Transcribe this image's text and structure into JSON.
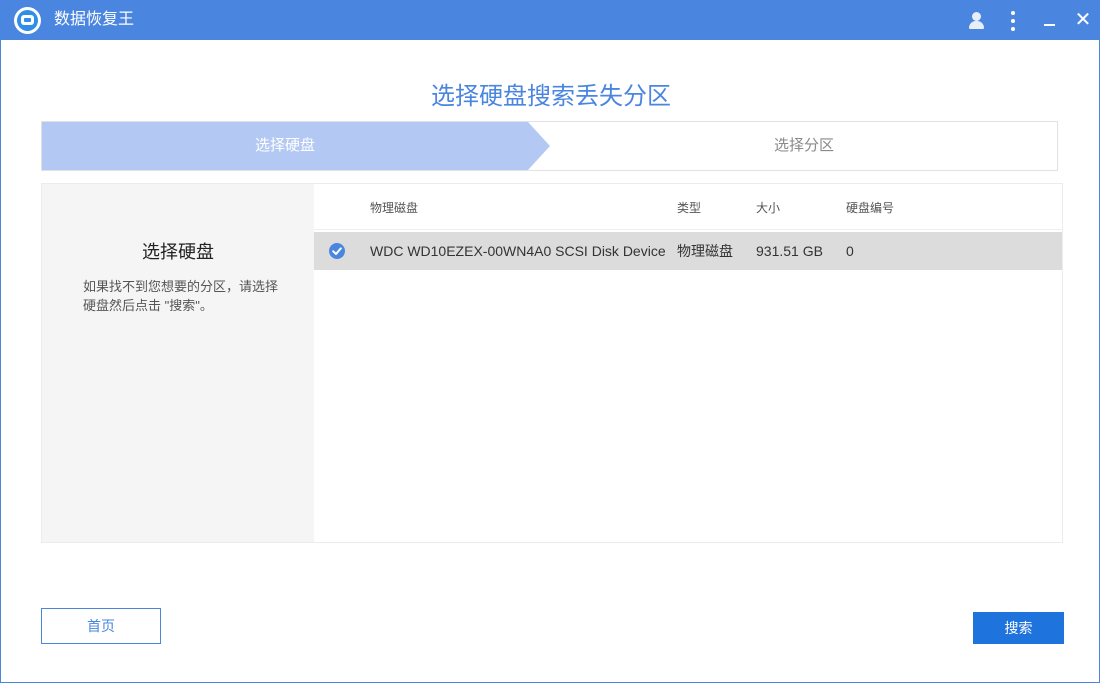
{
  "window": {
    "title": "数据恢复王"
  },
  "page": {
    "heading": "选择硬盘搜索丢失分区"
  },
  "steps": [
    {
      "label": "选择硬盘",
      "active": true
    },
    {
      "label": "选择分区",
      "active": false
    }
  ],
  "left_panel": {
    "title": "选择硬盘",
    "description": "如果找不到您想要的分区，请选择硬盘然后点击 \"搜索\"。"
  },
  "table": {
    "columns": [
      "物理磁盘",
      "类型",
      "大小",
      "硬盘编号"
    ],
    "rows": [
      {
        "name": "WDC WD10EZEX-00WN4A0 SCSI Disk Device",
        "type": "物理磁盘",
        "size": "931.51 GB",
        "id": "0",
        "selected": true
      }
    ]
  },
  "buttons": {
    "home": "首页",
    "search": "搜索"
  },
  "colors": {
    "accent": "#4a86e0",
    "step_active": "#b3c8f2",
    "primary_button": "#1f73dc",
    "selected_row": "#dcdcdc"
  },
  "icons": {
    "logo": "app-logo-icon",
    "user": "user-icon",
    "menu": "more-vertical-icon",
    "minimize": "minimize-icon",
    "close": "close-icon",
    "check": "check-circle-icon"
  }
}
